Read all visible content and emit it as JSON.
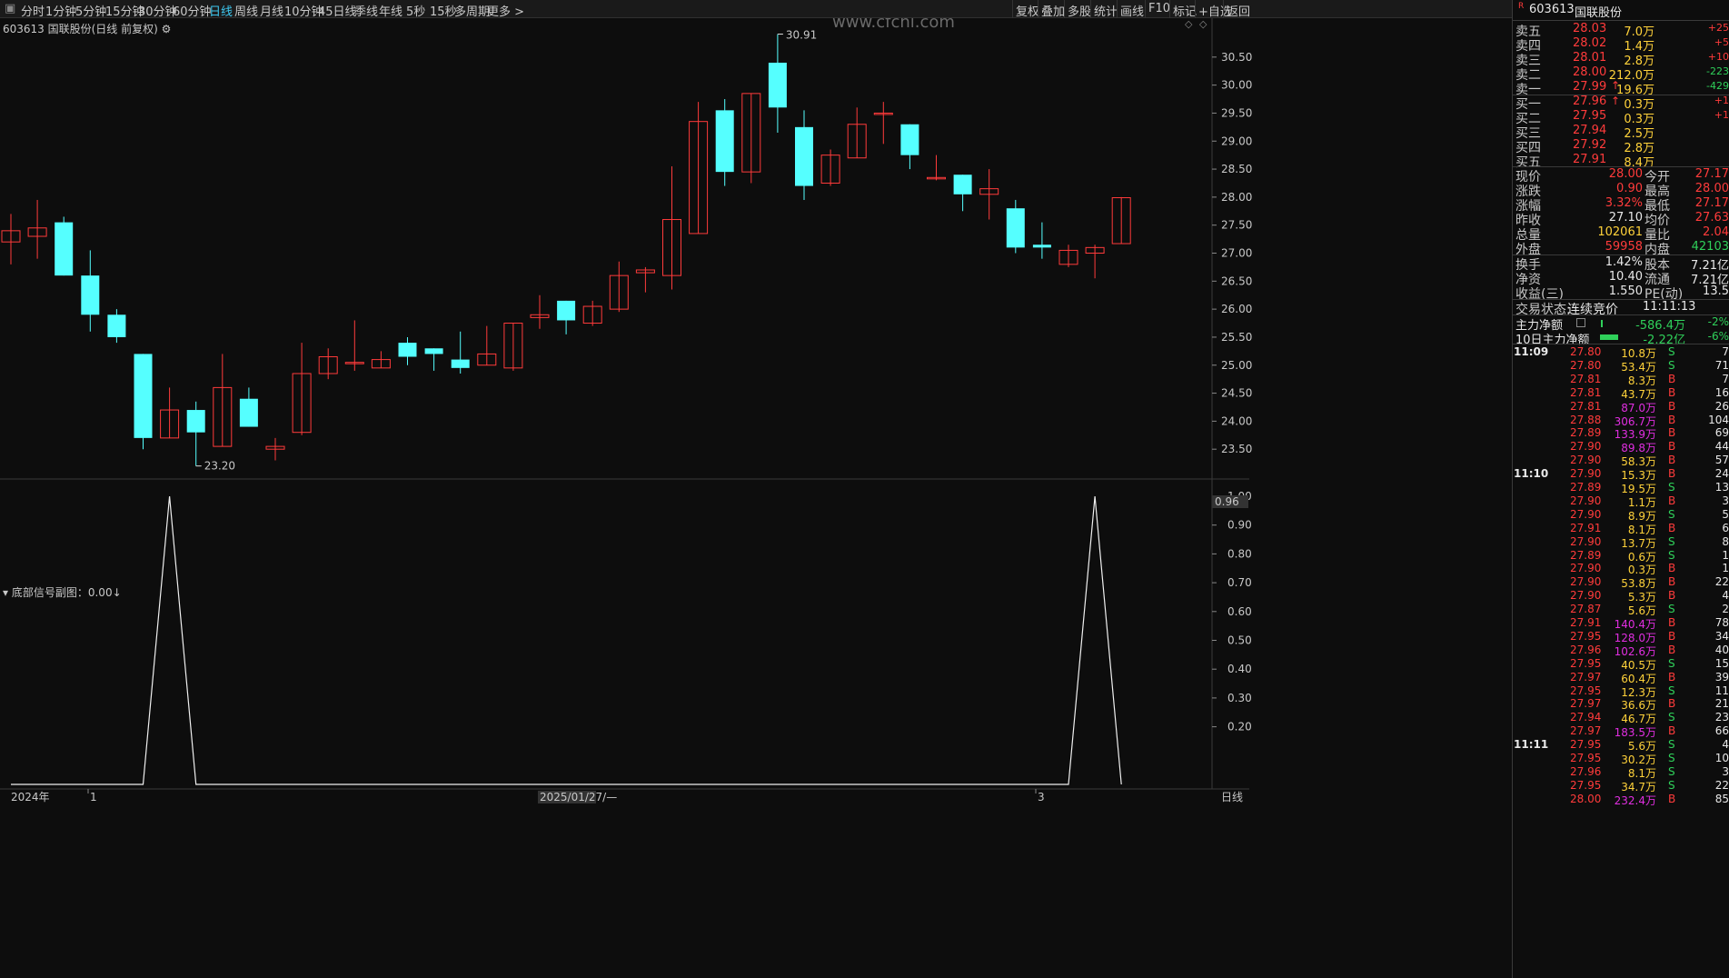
{
  "toolbar": {
    "periods": [
      "分时",
      "1分钟",
      "5分钟",
      "15分钟",
      "30分钟",
      "60分钟",
      "日线",
      "周线",
      "月线",
      "10分钟",
      "45日线",
      "季线",
      "年线",
      "5秒",
      "15秒",
      "多周期",
      "更多 >"
    ],
    "active": "日线",
    "actions": [
      "复权",
      "叠加",
      "多股",
      "统计",
      "画线",
      "F10",
      "标记",
      "+自选",
      "返回"
    ]
  },
  "watermark": "www.cfchi.com",
  "main_chart": {
    "title": "603613 国联股份(日线 前复权)",
    "high_label": "30.91",
    "low_label": "23.20"
  },
  "sub_chart": {
    "title": "底部信号副图：0.00↓",
    "cursor_value": "0.96"
  },
  "bottom_axis": {
    "year": "2024年",
    "m1": "1",
    "date": "2025/01/27/—",
    "m3": "3",
    "period": "日线"
  },
  "chart_data": [
    {
      "type": "candlestick",
      "ylim": [
        23.0,
        31.0
      ],
      "yticks": [
        "30.50",
        "30.00",
        "29.50",
        "29.00",
        "28.50",
        "28.00",
        "27.50",
        "27.00",
        "26.50",
        "26.00",
        "25.50",
        "25.00",
        "24.50",
        "24.00",
        "23.50"
      ],
      "candles": [
        {
          "o": 27.2,
          "c": 27.4,
          "h": 27.7,
          "l": 26.8
        },
        {
          "o": 27.3,
          "c": 27.45,
          "h": 27.95,
          "l": 26.9
        },
        {
          "o": 27.55,
          "c": 26.6,
          "h": 27.65,
          "l": 26.6
        },
        {
          "o": 26.6,
          "c": 25.9,
          "h": 27.05,
          "l": 25.6
        },
        {
          "o": 25.9,
          "c": 25.5,
          "h": 26.0,
          "l": 25.4
        },
        {
          "o": 25.2,
          "c": 23.7,
          "h": 25.2,
          "l": 23.5
        },
        {
          "o": 23.7,
          "c": 24.2,
          "h": 24.6,
          "l": 23.7
        },
        {
          "o": 24.2,
          "c": 23.8,
          "h": 24.35,
          "l": 23.2
        },
        {
          "o": 23.55,
          "c": 24.6,
          "h": 25.2,
          "l": 23.55
        },
        {
          "o": 24.4,
          "c": 23.9,
          "h": 24.6,
          "l": 23.9
        },
        {
          "o": 23.5,
          "c": 23.55,
          "h": 23.7,
          "l": 23.3
        },
        {
          "o": 23.8,
          "c": 24.85,
          "h": 25.4,
          "l": 23.75
        },
        {
          "o": 24.85,
          "c": 25.15,
          "h": 25.3,
          "l": 24.75
        },
        {
          "o": 25.05,
          "c": 25.05,
          "h": 25.8,
          "l": 24.9
        },
        {
          "o": 24.95,
          "c": 25.1,
          "h": 25.25,
          "l": 24.95
        },
        {
          "o": 25.4,
          "c": 25.15,
          "h": 25.5,
          "l": 25.0
        },
        {
          "o": 25.3,
          "c": 25.2,
          "h": 25.3,
          "l": 24.9
        },
        {
          "o": 25.1,
          "c": 24.95,
          "h": 25.6,
          "l": 24.85
        },
        {
          "o": 25.0,
          "c": 25.2,
          "h": 25.7,
          "l": 25.0
        },
        {
          "o": 24.95,
          "c": 25.75,
          "h": 25.75,
          "l": 24.9
        },
        {
          "o": 25.85,
          "c": 25.9,
          "h": 26.25,
          "l": 25.65
        },
        {
          "o": 26.15,
          "c": 25.8,
          "h": 26.15,
          "l": 25.55
        },
        {
          "o": 25.75,
          "c": 26.05,
          "h": 26.15,
          "l": 25.7
        },
        {
          "o": 26.0,
          "c": 26.6,
          "h": 26.85,
          "l": 25.95
        },
        {
          "o": 26.65,
          "c": 26.7,
          "h": 26.75,
          "l": 26.3
        },
        {
          "o": 26.6,
          "c": 27.6,
          "h": 28.55,
          "l": 26.35
        },
        {
          "o": 27.35,
          "c": 29.35,
          "h": 29.7,
          "l": 27.35
        },
        {
          "o": 29.55,
          "c": 28.45,
          "h": 29.75,
          "l": 28.2
        },
        {
          "o": 28.45,
          "c": 29.85,
          "h": 29.85,
          "l": 28.25
        },
        {
          "o": 30.4,
          "c": 29.6,
          "h": 30.91,
          "l": 29.15
        },
        {
          "o": 29.25,
          "c": 28.2,
          "h": 29.55,
          "l": 27.95
        },
        {
          "o": 28.25,
          "c": 28.75,
          "h": 28.85,
          "l": 28.2
        },
        {
          "o": 28.7,
          "c": 29.3,
          "h": 29.6,
          "l": 28.7
        },
        {
          "o": 29.5,
          "c": 29.5,
          "h": 29.7,
          "l": 28.95
        },
        {
          "o": 29.3,
          "c": 28.75,
          "h": 29.3,
          "l": 28.5
        },
        {
          "o": 28.35,
          "c": 28.35,
          "h": 28.75,
          "l": 28.3
        },
        {
          "o": 28.4,
          "c": 28.05,
          "h": 28.4,
          "l": 27.75
        },
        {
          "o": 28.05,
          "c": 28.15,
          "h": 28.5,
          "l": 27.6
        },
        {
          "o": 27.8,
          "c": 27.1,
          "h": 27.95,
          "l": 27.0
        },
        {
          "o": 27.15,
          "c": 27.1,
          "h": 27.55,
          "l": 26.9
        },
        {
          "o": 26.8,
          "c": 27.05,
          "h": 27.15,
          "l": 26.75
        },
        {
          "o": 27.0,
          "c": 27.1,
          "h": 27.15,
          "l": 26.55
        },
        {
          "o": 27.17,
          "c": 27.99,
          "h": 28.0,
          "l": 27.17
        }
      ]
    },
    {
      "type": "line",
      "name": "底部信号",
      "ylim": [
        0.0,
        1.0
      ],
      "yticks": [
        "1.00",
        "0.90",
        "0.80",
        "0.70",
        "0.60",
        "0.50",
        "0.40",
        "0.30",
        "0.20"
      ],
      "points": [
        [
          0,
          0
        ],
        [
          5,
          0
        ],
        [
          6,
          1
        ],
        [
          7,
          0
        ],
        [
          40,
          0
        ],
        [
          41,
          1
        ],
        [
          42,
          0
        ]
      ]
    }
  ],
  "quotes": {
    "code": "603613",
    "name": "国联股份",
    "asks": [
      {
        "label": "卖五",
        "price": "28.03",
        "vol": "7.0万",
        "chg": "+25"
      },
      {
        "label": "卖四",
        "price": "28.02",
        "vol": "1.4万",
        "chg": "+5"
      },
      {
        "label": "卖三",
        "price": "28.01",
        "vol": "2.8万",
        "chg": "+10"
      },
      {
        "label": "卖二",
        "price": "28.00",
        "vol": "212.0万",
        "chg": "-223"
      },
      {
        "label": "卖一",
        "price": "27.99",
        "vol": "19.6万",
        "chg": "-429"
      }
    ],
    "bids": [
      {
        "label": "买一",
        "price": "27.96",
        "vol": "0.3万",
        "chg": "+1"
      },
      {
        "label": "买二",
        "price": "27.95",
        "vol": "0.3万",
        "chg": "+1"
      },
      {
        "label": "买三",
        "price": "27.94",
        "vol": "2.5万",
        "chg": ""
      },
      {
        "label": "买四",
        "price": "27.92",
        "vol": "2.8万",
        "chg": ""
      },
      {
        "label": "买五",
        "price": "27.91",
        "vol": "8.4万",
        "chg": ""
      }
    ],
    "stats": [
      {
        "l1": "现价",
        "v1": "28.00",
        "l2": "今开",
        "v2": "27.17"
      },
      {
        "l1": "涨跌",
        "v1": "0.90",
        "l2": "最高",
        "v2": "28.00"
      },
      {
        "l1": "涨幅",
        "v1": "3.32%",
        "l2": "最低",
        "v2": "27.17"
      },
      {
        "l1": "昨收",
        "v1": "27.10",
        "l2": "均价",
        "v2": "27.63"
      },
      {
        "l1": "总量",
        "v1": "102061",
        "l2": "量比",
        "v2": "2.04"
      },
      {
        "l1": "外盘",
        "v1": "59958",
        "l2": "内盘",
        "v2": "42103"
      }
    ],
    "stats2": [
      {
        "l1": "换手",
        "v1": "1.42%",
        "l2": "股本",
        "v2": "7.21亿"
      },
      {
        "l1": "净资",
        "v1": "10.40",
        "l2": "流通",
        "v2": "7.21亿"
      },
      {
        "l1": "收益(三)",
        "v1": "1.550",
        "l2": "PE(动)",
        "v2": "13.5"
      }
    ],
    "status_label": "交易状态:",
    "status_value": "连续竞价",
    "status_time": "11:11:13",
    "flow": [
      {
        "label": "主力净额",
        "value": "-586.4万",
        "pct": "-2%"
      },
      {
        "label": "10日主力净额",
        "value": "-2.22亿",
        "pct": "-6%"
      }
    ],
    "ticks": [
      {
        "t": "11:09",
        "p": "27.80",
        "v": "10.8万",
        "d": "S",
        "n": "7",
        "vc": "yellow"
      },
      {
        "t": "",
        "p": "27.80",
        "v": "53.4万",
        "d": "S",
        "n": "71",
        "vc": "yellow"
      },
      {
        "t": "",
        "p": "27.81",
        "v": "8.3万",
        "d": "B",
        "n": "7",
        "vc": "yellow"
      },
      {
        "t": "",
        "p": "27.81",
        "v": "43.7万",
        "d": "B",
        "n": "16",
        "vc": "yellow"
      },
      {
        "t": "",
        "p": "27.81",
        "v": "87.0万",
        "d": "B",
        "n": "26",
        "vc": "magenta"
      },
      {
        "t": "",
        "p": "27.88",
        "v": "306.7万",
        "d": "B",
        "n": "104",
        "vc": "magenta"
      },
      {
        "t": "",
        "p": "27.89",
        "v": "133.9万",
        "d": "B",
        "n": "69",
        "vc": "magenta"
      },
      {
        "t": "",
        "p": "27.90",
        "v": "89.8万",
        "d": "B",
        "n": "44",
        "vc": "magenta"
      },
      {
        "t": "",
        "p": "27.90",
        "v": "58.3万",
        "d": "B",
        "n": "57",
        "vc": "yellow"
      },
      {
        "t": "11:10",
        "p": "27.90",
        "v": "15.3万",
        "d": "B",
        "n": "24",
        "vc": "yellow"
      },
      {
        "t": "",
        "p": "27.89",
        "v": "19.5万",
        "d": "S",
        "n": "13",
        "vc": "yellow"
      },
      {
        "t": "",
        "p": "27.90",
        "v": "1.1万",
        "d": "B",
        "n": "3",
        "vc": "yellow"
      },
      {
        "t": "",
        "p": "27.90",
        "v": "8.9万",
        "d": "S",
        "n": "5",
        "vc": "yellow"
      },
      {
        "t": "",
        "p": "27.91",
        "v": "8.1万",
        "d": "B",
        "n": "6",
        "vc": "yellow"
      },
      {
        "t": "",
        "p": "27.90",
        "v": "13.7万",
        "d": "S",
        "n": "8",
        "vc": "yellow"
      },
      {
        "t": "",
        "p": "27.89",
        "v": "0.6万",
        "d": "S",
        "n": "1",
        "vc": "yellow"
      },
      {
        "t": "",
        "p": "27.90",
        "v": "0.3万",
        "d": "B",
        "n": "1",
        "vc": "yellow"
      },
      {
        "t": "",
        "p": "27.90",
        "v": "53.8万",
        "d": "B",
        "n": "22",
        "vc": "yellow"
      },
      {
        "t": "",
        "p": "27.90",
        "v": "5.3万",
        "d": "B",
        "n": "4",
        "vc": "yellow"
      },
      {
        "t": "",
        "p": "27.87",
        "v": "5.6万",
        "d": "S",
        "n": "2",
        "vc": "yellow"
      },
      {
        "t": "",
        "p": "27.91",
        "v": "140.4万",
        "d": "B",
        "n": "78",
        "vc": "magenta"
      },
      {
        "t": "",
        "p": "27.95",
        "v": "128.0万",
        "d": "B",
        "n": "34",
        "vc": "magenta"
      },
      {
        "t": "",
        "p": "27.96",
        "v": "102.6万",
        "d": "B",
        "n": "40",
        "vc": "magenta"
      },
      {
        "t": "",
        "p": "27.95",
        "v": "40.5万",
        "d": "S",
        "n": "15",
        "vc": "yellow"
      },
      {
        "t": "",
        "p": "27.97",
        "v": "60.4万",
        "d": "B",
        "n": "39",
        "vc": "yellow"
      },
      {
        "t": "",
        "p": "27.95",
        "v": "12.3万",
        "d": "S",
        "n": "11",
        "vc": "yellow"
      },
      {
        "t": "",
        "p": "27.97",
        "v": "36.6万",
        "d": "B",
        "n": "21",
        "vc": "yellow"
      },
      {
        "t": "",
        "p": "27.94",
        "v": "46.7万",
        "d": "S",
        "n": "23",
        "vc": "yellow"
      },
      {
        "t": "",
        "p": "27.97",
        "v": "183.5万",
        "d": "B",
        "n": "66",
        "vc": "magenta"
      },
      {
        "t": "11:11",
        "p": "27.95",
        "v": "5.6万",
        "d": "S",
        "n": "4",
        "vc": "yellow"
      },
      {
        "t": "",
        "p": "27.95",
        "v": "30.2万",
        "d": "S",
        "n": "10",
        "vc": "yellow"
      },
      {
        "t": "",
        "p": "27.96",
        "v": "8.1万",
        "d": "S",
        "n": "3",
        "vc": "yellow"
      },
      {
        "t": "",
        "p": "27.95",
        "v": "34.7万",
        "d": "S",
        "n": "22",
        "vc": "yellow"
      },
      {
        "t": "",
        "p": "28.00",
        "v": "232.4万",
        "d": "B",
        "n": "85",
        "vc": "magenta"
      }
    ]
  },
  "colors": {
    "up": "#ff3b3b",
    "down": "#55ffff",
    "bg": "#0d0d0d",
    "active": "#3dc8f0"
  }
}
